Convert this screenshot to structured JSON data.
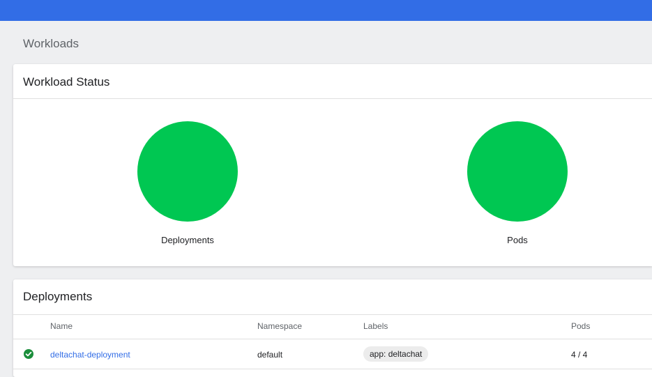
{
  "page": {
    "title": "Workloads"
  },
  "workload_status": {
    "title": "Workload Status",
    "charts": [
      {
        "label": "Deployments",
        "color": "#00c752"
      },
      {
        "label": "Pods",
        "color": "#00c752"
      }
    ]
  },
  "deployments": {
    "title": "Deployments",
    "columns": [
      "Name",
      "Namespace",
      "Labels",
      "Pods"
    ],
    "rows": [
      {
        "status_icon": "check-circle-icon",
        "name": "deltachat-deployment",
        "namespace": "default",
        "label": "app: deltachat",
        "pods": "4 / 4"
      }
    ]
  },
  "colors": {
    "topbar": "#326de6",
    "success": "#00c752",
    "link": "#326de6"
  }
}
